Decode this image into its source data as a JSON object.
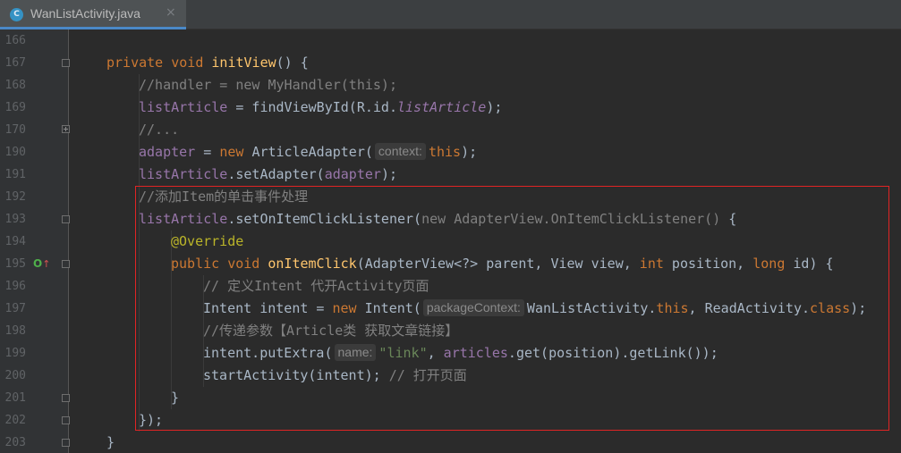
{
  "tab": {
    "icon_letter": "C",
    "title": "WanListActivity.java",
    "close_glyph": "×"
  },
  "gutter": {
    "line_numbers": [
      "166",
      "167",
      "168",
      "169",
      "170",
      "190",
      "191",
      "192",
      "193",
      "194",
      "195",
      "196",
      "197",
      "198",
      "199",
      "200",
      "201",
      "202",
      "203"
    ],
    "override_marker": {
      "circle": "O",
      "arrow": "↑"
    }
  },
  "code": {
    "l167": {
      "kw": "private void ",
      "fn": "initView",
      "rest": "() {"
    },
    "l168": "//handler = new MyHandler(this);",
    "l169": {
      "field": "listArticle",
      "eq": " = findViewById(R.id.",
      "ref": "listArticle",
      "end": ");"
    },
    "l170": "//...",
    "l190": {
      "field": "adapter",
      "eq": " = ",
      "kw": "new ",
      "cls": "ArticleAdapter(",
      "hint": "context:",
      "this": "this",
      "end": ");"
    },
    "l191": {
      "field": "listArticle",
      "call": ".setAdapter(",
      "arg": "adapter",
      "end": ");"
    },
    "l192": "//添加Item的单击事件处理",
    "l193": {
      "field": "listArticle",
      "call": ".setOnItemClickListener(",
      "gray": "new AdapterView.OnItemClickListener()",
      "end": " {"
    },
    "l194": "@Override",
    "l195": {
      "kw": "public void ",
      "fn": "onItemClick",
      "p1": "(AdapterView<?> parent, View view, ",
      "kw2": "int ",
      "p2": "position, ",
      "kw3": "long ",
      "p3": "id) {"
    },
    "l196": "// 定义Intent 代开Activity页面",
    "l197": {
      "a": "Intent intent = ",
      "kw": "new ",
      "b": "Intent(",
      "hint": "packageContext:",
      "c": "WanListActivity.",
      "kw2": "this",
      "d": ", ReadActivity.",
      "kw3": "class",
      "e": ");"
    },
    "l198": "//传递参数【Article类 获取文章链接】",
    "l199": {
      "a": "intent.putExtra(",
      "hint": "name:",
      "str": "\"link\"",
      "sep": ", ",
      "field": "articles",
      "b": ".get(position).getLink());"
    },
    "l200": {
      "a": "startActivity(intent); ",
      "cm": "// 打开页面"
    },
    "l201": "}",
    "l202": "});",
    "l203": "}"
  },
  "colors": {
    "background": "#2b2b2b",
    "gutter": "#313335",
    "keyword": "#cc7832",
    "method": "#ffc66d",
    "field": "#9876aa",
    "comment": "#808080",
    "annotation": "#bbb529",
    "string": "#6a8759",
    "highlight_box": "#e02424"
  }
}
